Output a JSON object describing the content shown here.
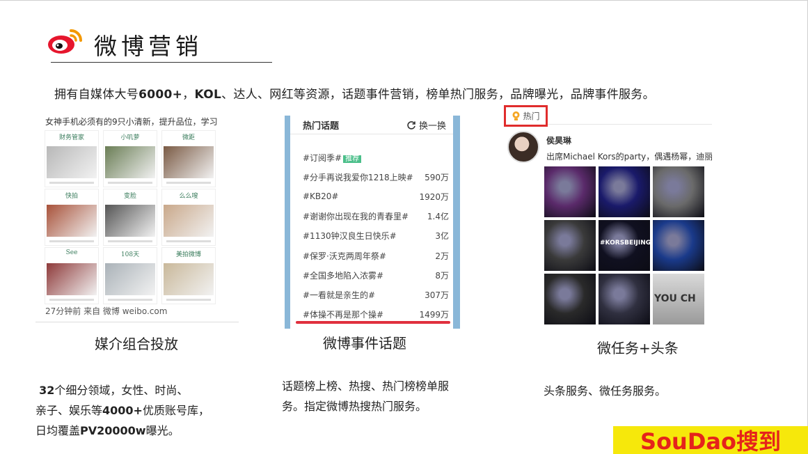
{
  "header": {
    "title": "微博营销",
    "intro_parts": [
      "拥有自媒体大号",
      "6000+",
      "，",
      "KOL",
      "、达人、网红等资源，话题事件营销，榜单热门服务，品牌曝光，品牌事件服务。"
    ]
  },
  "panel_media": {
    "headline": "女神手机必须有的9只小清新，提升品位，学习",
    "tiles": [
      {
        "label": "财务管家",
        "color": "#b8b8b8"
      },
      {
        "label": "小叽萝",
        "color": "#6a7d55"
      },
      {
        "label": "微距",
        "color": "#7a5a44"
      },
      {
        "label": "快拍",
        "color": "#a8523a"
      },
      {
        "label": "变脸",
        "color": "#555555"
      },
      {
        "label": "么么嗖",
        "color": "#c9a88a"
      },
      {
        "label": "See",
        "color": "#8e3a3a"
      },
      {
        "label": "108天",
        "color": "#aab2b8"
      },
      {
        "label": "美拍微博",
        "color": "#c9b89a"
      }
    ],
    "footer": "27分钟前 来自 微博 weibo.com",
    "caption": "媒介组合投放"
  },
  "panel_topics": {
    "title": "热门话题",
    "refresh_label": "换一换",
    "topics": [
      {
        "name": "#订阅季#",
        "tag": "推荐",
        "count": ""
      },
      {
        "name": "#分手再说我爱你1218上映#",
        "tag": "",
        "count": "590万"
      },
      {
        "name": "#KB20#",
        "tag": "",
        "count": "1920万"
      },
      {
        "name": "#谢谢你出现在我的青春里#",
        "tag": "",
        "count": "1.4亿"
      },
      {
        "name": "#1130钟汉良生日快乐#",
        "tag": "",
        "count": "3亿"
      },
      {
        "name": "#保罗·沃克两周年祭#",
        "tag": "",
        "count": "2万"
      },
      {
        "name": "#全国多地陷入浓雾#",
        "tag": "",
        "count": "8万"
      },
      {
        "name": "#一看就是亲生的#",
        "tag": "",
        "count": "307万"
      },
      {
        "name": "#体操不再是那个操#",
        "tag": "",
        "count": "1499万"
      }
    ],
    "caption": "微博事件话题"
  },
  "panel_headline": {
    "badge": "热门",
    "user_name": "侯昊琳",
    "post_text": "出席Michael Kors的party，偶遇杨幂，迪丽",
    "photo_colors": [
      "#5a2a6a",
      "#1a1a6a",
      "#6a6a6a",
      "#3a3a3a",
      "#101020",
      "#1a3a8a",
      "#2a2a2a",
      "#303040",
      "#b8b8b8"
    ],
    "photo_texts": [
      "",
      "",
      "",
      "",
      "#KORSBEIJING#",
      "",
      "",
      "",
      "YOU CH"
    ],
    "caption": "微任务+头条"
  },
  "descriptions": {
    "media": [
      "32",
      "个细分领域，女性、时尚、",
      "亲子、娱乐等",
      "4000+",
      "优质账号库，",
      "日均覆盖",
      "PV20000w",
      "曝光。"
    ],
    "topics": "话题榜上榜、热搜、热门榜榜单服务。指定微博热搜热门服务。",
    "headline": "头条服务、微任务服务。"
  },
  "watermark": "SouDao搜到",
  "colors": {
    "accent_red": "#e02c2c",
    "topic_panel_blue": "#8ab7d8",
    "recommend_green": "#4bbf8a",
    "watermark_bg": "#f6e80b",
    "watermark_text": "#e5231b"
  }
}
